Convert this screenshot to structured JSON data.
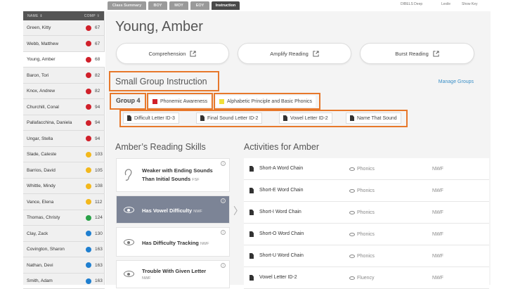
{
  "tabs": [
    "Class Summary",
    "BOY",
    "MOY",
    "EOY",
    "Instruction"
  ],
  "toplinks": [
    "DIBELS Deep",
    "Lexile",
    "Show Key"
  ],
  "sidebar": {
    "header_name": "NAME ⇕",
    "header_comp": "COMP ⇧",
    "students": [
      {
        "name": "Green, Kitty",
        "score": "67",
        "color": "#d0202a"
      },
      {
        "name": "Webb, Matthew",
        "score": "67",
        "color": "#d0202a"
      },
      {
        "name": "Young, Amber",
        "score": "68",
        "color": "#d0202a"
      },
      {
        "name": "Baron, Tori",
        "score": "82",
        "color": "#d0202a"
      },
      {
        "name": "Knox, Andrew",
        "score": "82",
        "color": "#d0202a"
      },
      {
        "name": "Churchill, Conal",
        "score": "94",
        "color": "#d0202a"
      },
      {
        "name": "Pallafacchina, Daniela",
        "score": "94",
        "color": "#d0202a"
      },
      {
        "name": "Ungar, Stella",
        "score": "94",
        "color": "#d0202a"
      },
      {
        "name": "Slade, Caleste",
        "score": "103",
        "color": "#f3b81c"
      },
      {
        "name": "Barrios, David",
        "score": "105",
        "color": "#f3b81c"
      },
      {
        "name": "Whittle, Mindy",
        "score": "108",
        "color": "#f3b81c"
      },
      {
        "name": "Vance, Elena",
        "score": "112",
        "color": "#f3b81c"
      },
      {
        "name": "Thomas, Christy",
        "score": "124",
        "color": "#2aa148"
      },
      {
        "name": "Clay, Zack",
        "score": "130",
        "color": "#1f7fd0"
      },
      {
        "name": "Covington, Sharon",
        "score": "163",
        "color": "#1f7fd0"
      },
      {
        "name": "Nathan, Devi",
        "score": "163",
        "color": "#1f7fd0"
      },
      {
        "name": "Smith, Adam",
        "score": "163",
        "color": "#1f7fd0"
      }
    ]
  },
  "main": {
    "student_name": "Young, Amber",
    "pills": [
      "Comprehension",
      "Amplify Reading",
      "Burst Reading"
    ],
    "sgi_title": "Small Group Instruction",
    "manage_groups": "Manage Groups",
    "group_label": "Group 4",
    "focus": [
      {
        "label": "Phonemic Awareness",
        "color": "#d0202a"
      },
      {
        "label": "Alphabetic Principle and Basic Phonics",
        "color": "#f0e03a"
      }
    ],
    "group_activities": [
      "Difficult Letter ID-3",
      "Final Sound Letter ID-2",
      "Vowel Letter ID-2",
      "Name That Sound"
    ],
    "skills_title": "Amber’s Reading Skills",
    "activities_title": "Activities for Amber",
    "skills": [
      {
        "line1": "Weaker with Ending Sounds",
        "line2": "Than Initial Sounds",
        "tag": "FSF"
      },
      {
        "line1": "Has Vowel Difficulty",
        "tag": "NWF"
      },
      {
        "line1": "Has Difficulty Tracking",
        "tag": "NWF"
      },
      {
        "line1": "Trouble With Given Letter",
        "tag": "NWF"
      }
    ],
    "activities": [
      {
        "name": "Short-A Word Chain",
        "category": "Phonics",
        "measure": "NWF"
      },
      {
        "name": "Short-E Word Chain",
        "category": "Phonics",
        "measure": "NWF"
      },
      {
        "name": "Short-I Word Chain",
        "category": "Phonics",
        "measure": "NWF"
      },
      {
        "name": "Short-O Word Chain",
        "category": "Phonics",
        "measure": "NWF"
      },
      {
        "name": "Short-U Word Chain",
        "category": "Phonics",
        "measure": "NWF"
      },
      {
        "name": "Vowel Letter ID-2",
        "category": "Fluency",
        "measure": "NWF"
      }
    ]
  },
  "colors": {
    "highlight": "#e7782b",
    "link": "#3a8fc7",
    "active_skill": "#7c8496"
  }
}
